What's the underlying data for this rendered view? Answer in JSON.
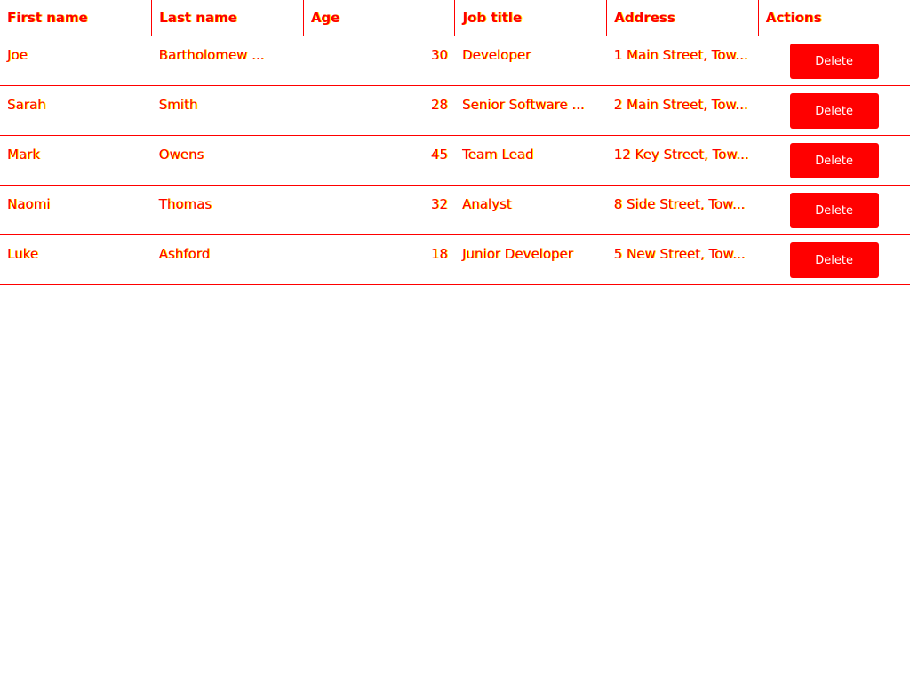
{
  "table": {
    "headers": [
      "First name",
      "Last name",
      "Age",
      "Job title",
      "Address",
      "Actions"
    ],
    "rows": [
      {
        "first": "Joe",
        "last": "Bartholomew ...",
        "age": "30",
        "job": "Developer",
        "address": "1 Main Street, Tow..."
      },
      {
        "first": "Sarah",
        "last": "Smith",
        "age": "28",
        "job": "Senior Software ...",
        "address": "2 Main Street, Tow..."
      },
      {
        "first": "Mark",
        "last": "Owens",
        "age": "45",
        "job": "Team Lead",
        "address": "12 Key Street, Tow..."
      },
      {
        "first": "Naomi",
        "last": "Thomas",
        "age": "32",
        "job": "Analyst",
        "address": "8 Side Street, Tow..."
      },
      {
        "first": "Luke",
        "last": "Ashford",
        "age": "18",
        "job": "Junior Developer",
        "address": "5 New Street, Tow..."
      }
    ],
    "delete_label": "Delete"
  },
  "colors": {
    "accent": "#ff0000",
    "text_outline": "#ffea00"
  }
}
